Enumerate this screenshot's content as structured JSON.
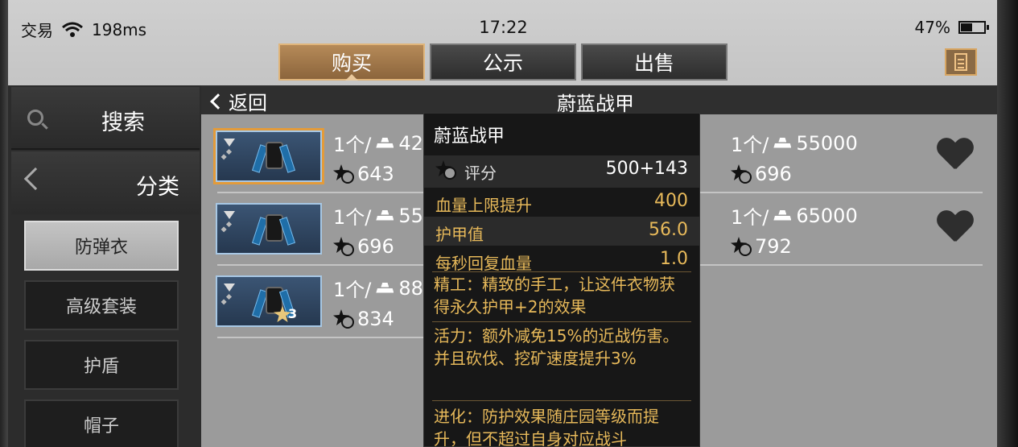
{
  "status": {
    "left_label": "交易",
    "ping": "198ms",
    "time": "17:22",
    "battery": "47%"
  },
  "tabs": [
    {
      "label": "购买",
      "active": true
    },
    {
      "label": "公示",
      "active": false
    },
    {
      "label": "出售",
      "active": false
    }
  ],
  "sidebar": {
    "search_label": "搜索",
    "category_label": "分类",
    "items": [
      {
        "label": "防弹衣",
        "active": true
      },
      {
        "label": "高级套装",
        "active": false
      },
      {
        "label": "护盾",
        "active": false
      },
      {
        "label": "帽子",
        "active": false
      }
    ]
  },
  "main": {
    "back_label": "返回",
    "title": "蔚蓝战甲"
  },
  "listings": [
    {
      "qty": "1个/",
      "price": "42",
      "score": "643",
      "selected": true
    },
    {
      "qty": "1个/",
      "price": "55000",
      "score": "696"
    },
    {
      "qty": "1个/",
      "price": "55",
      "score": "696"
    },
    {
      "qty": "1个/",
      "price": "65000",
      "score": "792"
    },
    {
      "qty": "1个/",
      "price": "88",
      "score": "834",
      "star_level": "3"
    }
  ],
  "tooltip": {
    "title": "蔚蓝战甲",
    "score_label": "评分",
    "score_value": "500+143",
    "stats": [
      {
        "label": "血量上限提升",
        "value": "400"
      },
      {
        "label": "护甲值",
        "value": "56.0"
      },
      {
        "label": "每秒回复血量",
        "value": "1.0"
      }
    ],
    "desc1": "精工：精致的手工，让这件衣物获得永久护甲+2的效果",
    "desc2": "活力：额外减免15%的近战伤害。并且砍伐、挖矿速度提升3%",
    "desc3": "进化：防护效果随庄园等级而提升，但不超过自身对应战斗"
  },
  "colors": {
    "accent_tab": "#b68a58",
    "tooltip_gold": "#e7b95a",
    "selected_outline": "#e39b3a"
  }
}
